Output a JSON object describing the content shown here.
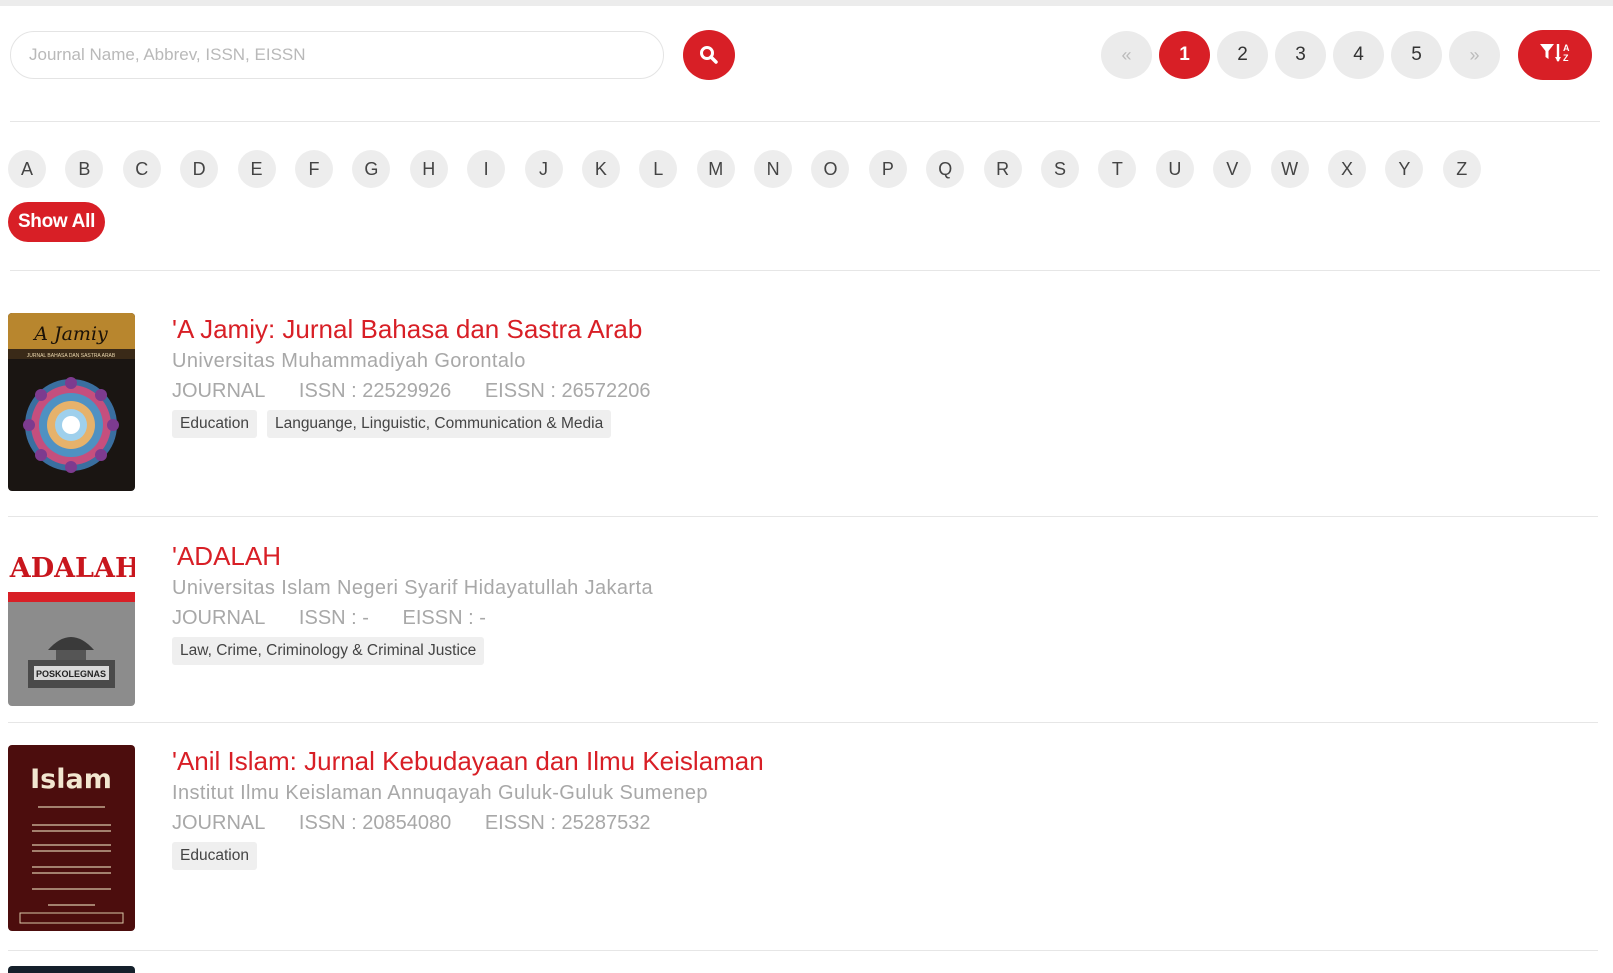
{
  "search": {
    "placeholder": "Journal Name, Abbrev, ISSN, EISSN",
    "value": ""
  },
  "pagination": {
    "prev": "«",
    "pages": [
      "1",
      "2",
      "3",
      "4",
      "5"
    ],
    "current": "1",
    "next": "»",
    "sort_icon": "filter-sort-az-icon"
  },
  "alphabet": [
    "A",
    "B",
    "C",
    "D",
    "E",
    "F",
    "G",
    "H",
    "I",
    "J",
    "K",
    "L",
    "M",
    "N",
    "O",
    "P",
    "Q",
    "R",
    "S",
    "T",
    "U",
    "V",
    "W",
    "X",
    "Y",
    "Z"
  ],
  "show_all_label": "Show All",
  "journals": [
    {
      "title": "'A Jamiy: Jurnal Bahasa dan Sastra Arab",
      "institution": "Universitas Muhammadiyah Gorontalo",
      "type": "JOURNAL",
      "issn": "ISSN : 22529926",
      "eissn": "EISSN : 26572206",
      "tags": [
        "Education",
        "Languange, Linguistic, Communication & Media"
      ],
      "cover_text": [
        "A Jamiy",
        "JURNAL BAHASA DAN SASTRA ARAB"
      ]
    },
    {
      "title": "'ADALAH",
      "institution": "Universitas Islam Negeri Syarif Hidayatullah Jakarta",
      "type": "JOURNAL",
      "issn": "ISSN : -",
      "eissn": "EISSN : -",
      "tags": [
        "Law, Crime, Criminology & Criminal Justice"
      ],
      "cover_text": [
        "'ADALAH",
        "POSKOLEGNAS"
      ]
    },
    {
      "title": "'Anil Islam: Jurnal Kebudayaan dan Ilmu Keislaman",
      "institution": "Institut Ilmu Keislaman Annuqayah Guluk-Guluk Sumenep",
      "type": "JOURNAL",
      "issn": "ISSN : 20854080",
      "eissn": "EISSN : 25287532",
      "tags": [
        "Education"
      ],
      "cover_text": [
        "Islam"
      ]
    }
  ],
  "colors": {
    "accent": "#d81f26",
    "muted_text": "#a8a8a8",
    "chip_bg": "#ededed"
  }
}
